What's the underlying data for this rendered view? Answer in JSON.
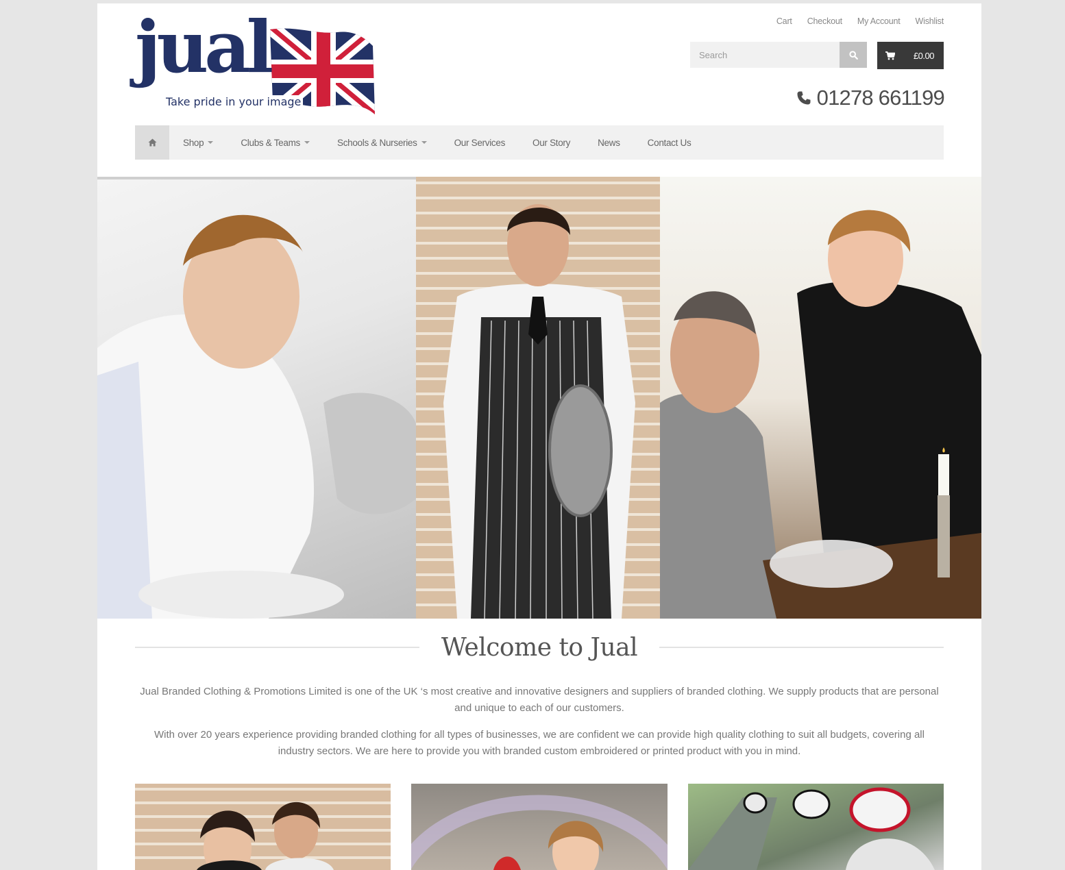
{
  "top_links": [
    "Cart",
    "Checkout",
    "My Account",
    "Wishlist"
  ],
  "logo": {
    "word": "jual",
    "tagline": "Take pride in your image"
  },
  "search": {
    "placeholder": "Search"
  },
  "cart": {
    "total": "£0.00"
  },
  "phone": "01278 661199",
  "nav": {
    "items": [
      {
        "label": "Shop",
        "dropdown": true
      },
      {
        "label": "Clubs & Teams",
        "dropdown": true
      },
      {
        "label": "Schools & Nurseries",
        "dropdown": true
      },
      {
        "label": "Our Services",
        "dropdown": false
      },
      {
        "label": "Our Story",
        "dropdown": false
      },
      {
        "label": "News",
        "dropdown": false
      },
      {
        "label": "Contact Us",
        "dropdown": false
      }
    ]
  },
  "welcome": {
    "title": "Welcome to Jual",
    "para1": "Jual Branded Clothing & Promotions Limited is one of the UK ‘s most creative and innovative designers and suppliers of branded clothing. We supply products that are personal and unique to each of our customers.",
    "para2": "With over 20 years experience providing branded clothing for all types of businesses, we are confident we can provide high quality clothing to suit all budgets, covering all industry sectors. We are here to provide you with branded custom embroidered or printed product with you in mind."
  },
  "colors": {
    "brand_navy": "#233266",
    "flag_red": "#d0203a",
    "dark_button": "#393939"
  }
}
